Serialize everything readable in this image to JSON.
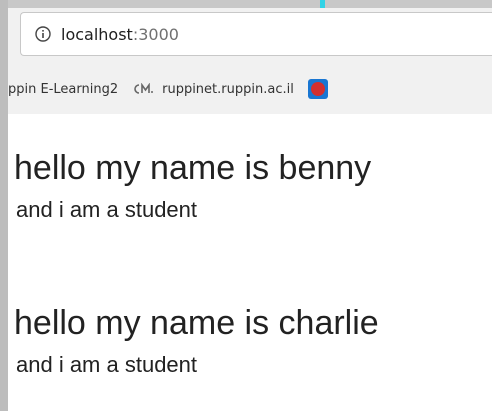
{
  "browser": {
    "url_host": "localhost",
    "url_port": ":3000",
    "info_icon": "info-icon"
  },
  "bookmarks": [
    {
      "label": "ppin E-Learning2"
    },
    {
      "label": "ruppinet.ruppin.ac.il",
      "icon": "cm-logo-icon"
    }
  ],
  "page": {
    "cards": [
      {
        "heading": "hello my name is benny",
        "subtext": "and i am a student"
      },
      {
        "heading": "hello my name is charlie",
        "subtext": "and i am a student"
      }
    ]
  },
  "colors": {
    "accent_cyan": "#31d3e6",
    "bookmark_icon_red": "#d32f2f",
    "bookmark_icon_blue": "#1976d2"
  }
}
